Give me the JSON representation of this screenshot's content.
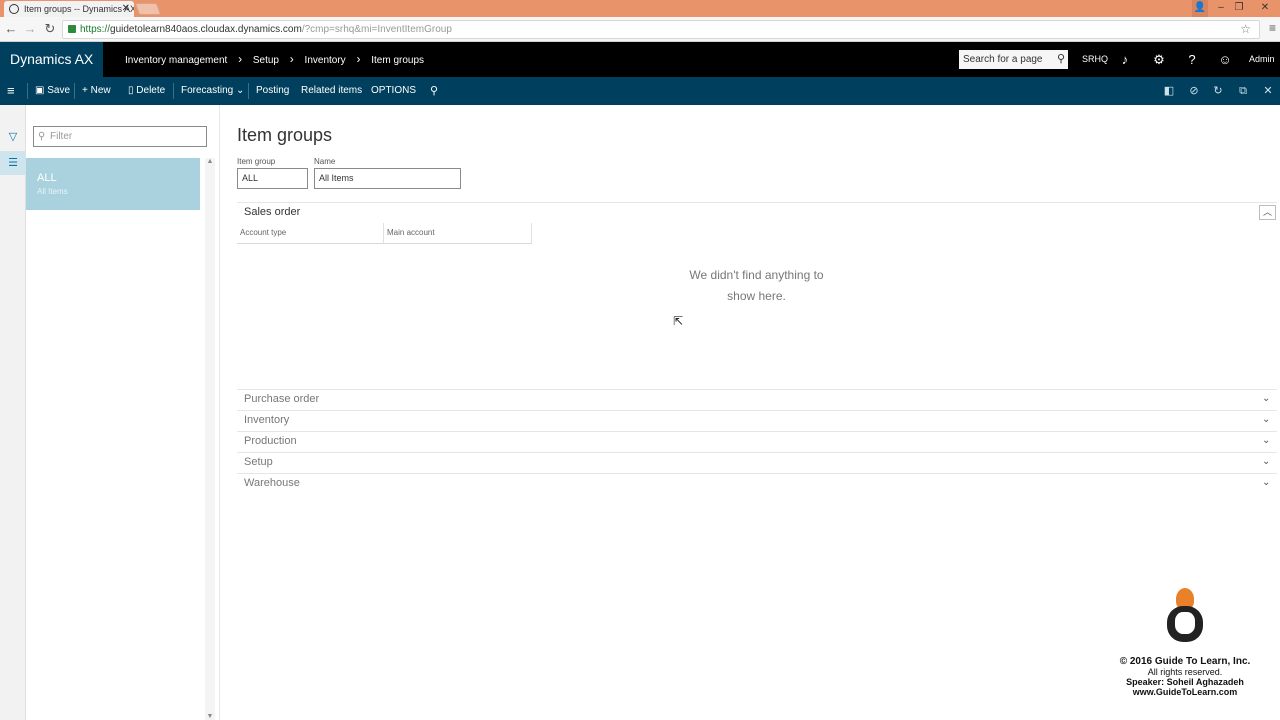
{
  "browser": {
    "tab_title": "Item groups -- Dynamics AX",
    "url_scheme": "https://",
    "url_host": "guidetolearn840aos.cloudax.dynamics.com",
    "url_path": "/?cmp=srhq&mi=InventItemGroup"
  },
  "topnav": {
    "brand": "Dynamics AX",
    "breadcrumbs": [
      "Inventory management",
      "Setup",
      "Inventory",
      "Item groups"
    ],
    "search_placeholder": "Search for a page",
    "company": "SRHQ",
    "user": "Admin"
  },
  "actions": {
    "save": "Save",
    "new": "New",
    "delete": "Delete",
    "forecasting": "Forecasting",
    "posting": "Posting",
    "related_items": "Related items",
    "options": "OPTIONS"
  },
  "listpane": {
    "filter_placeholder": "Filter",
    "items": [
      {
        "title": "ALL",
        "subtitle": "All Items"
      }
    ]
  },
  "main": {
    "title": "Item groups",
    "fields": {
      "item_group_label": "Item group",
      "item_group_value": "ALL",
      "name_label": "Name",
      "name_value": "All Items"
    },
    "sales_order": {
      "header": "Sales order",
      "columns": [
        "Account type",
        "Main account"
      ],
      "empty_message": "We didn't find anything to show here."
    },
    "collapsed_tabs": [
      "Purchase order",
      "Inventory",
      "Production",
      "Setup",
      "Warehouse"
    ]
  },
  "watermark": {
    "copyright": "2016 Guide To Learn, Inc.",
    "rights": "All rights reserved.",
    "speaker": "Speaker: Soheil Aghazadeh",
    "website": "www.GuideToLearn.com"
  },
  "colors": {
    "nav_black": "#000000",
    "action_pane": "#00405e",
    "selected_row": "#a9d2de",
    "browser_tabbar": "#e8936a"
  }
}
